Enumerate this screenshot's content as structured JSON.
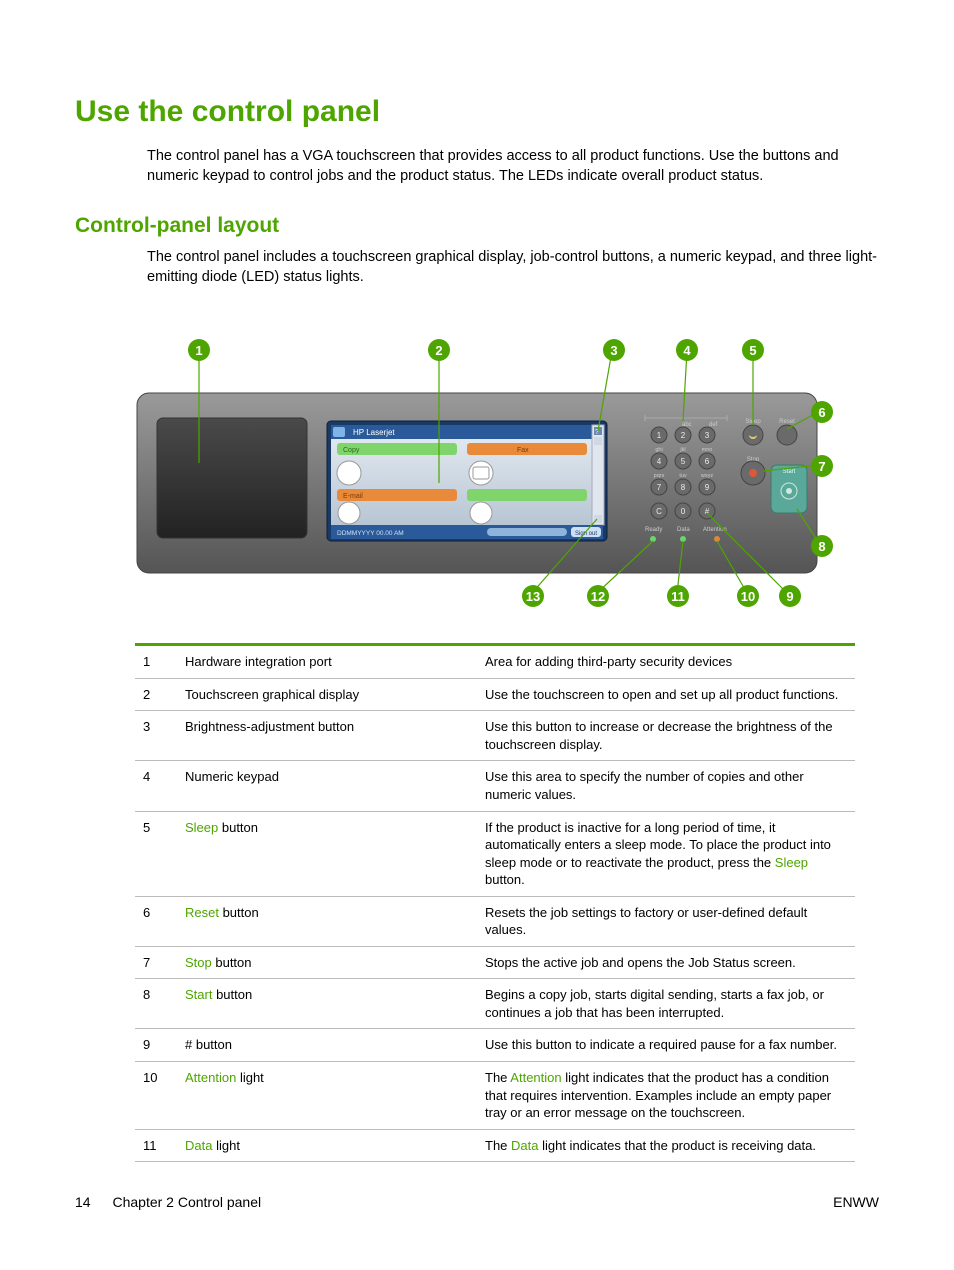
{
  "title": "Use the control panel",
  "intro": "The control panel has a VGA touchscreen that provides access to all product functions. Use the buttons and numeric keypad to control jobs and the product status. The LEDs indicate overall product status.",
  "section_title": "Control-panel layout",
  "section_intro": "The control panel includes a touchscreen graphical display, job-control buttons, a numeric keypad, and three light-emitting diode (LED) status lights.",
  "diagram": {
    "device_label": "HP Laserjet",
    "screen_labels": {
      "copy": "Copy",
      "fax": "Fax",
      "email": "E-mail",
      "date": "DDMMYYYY  00.00 AM",
      "signout": "Sign out"
    },
    "keypad_top": [
      "abc",
      "def"
    ],
    "keypad": [
      "1",
      "2",
      "3",
      "ghi",
      "jkl",
      "mno",
      "4",
      "5",
      "6",
      "pqrs",
      "tuv",
      "wxyz",
      "7",
      "8",
      "9",
      "C",
      "0",
      "#"
    ],
    "buttons": {
      "sleep": "Sleep",
      "reset": "Reset",
      "stop": "Stop",
      "start": "Start"
    },
    "leds": [
      "Ready",
      "Data",
      "Attention"
    ],
    "callouts": [
      "1",
      "2",
      "3",
      "4",
      "5",
      "6",
      "7",
      "8",
      "9",
      "10",
      "11",
      "12",
      "13"
    ]
  },
  "table": [
    {
      "n": "1",
      "name_plain": "Hardware integration port",
      "desc_plain": "Area for adding third-party security devices"
    },
    {
      "n": "2",
      "name_plain": "Touchscreen graphical display",
      "desc_plain": "Use the touchscreen to open and set up all product functions."
    },
    {
      "n": "3",
      "name_plain": "Brightness-adjustment button",
      "desc_plain": "Use this button to increase or decrease the brightness of the touchscreen display."
    },
    {
      "n": "4",
      "name_plain": "Numeric keypad",
      "desc_plain": "Use this area to specify the number of copies and other numeric values."
    },
    {
      "n": "5",
      "name_html": "<span class='kw'>Sleep</span> button",
      "desc_html": "If the product is inactive for a long period of time, it automatically enters a sleep mode. To place the product into sleep mode or to reactivate the product, press the <span class='kw'>Sleep</span> button."
    },
    {
      "n": "6",
      "name_html": "<span class='kw'>Reset</span> button",
      "desc_plain": "Resets the job settings to factory or user-defined default values."
    },
    {
      "n": "7",
      "name_html": "<span class='kw'>Stop</span> button",
      "desc_plain": "Stops the active job and opens the Job Status screen."
    },
    {
      "n": "8",
      "name_html": "<span class='kw'>Start</span> button",
      "desc_plain": "Begins a copy job, starts digital sending, starts a fax job, or continues a job that has been interrupted."
    },
    {
      "n": "9",
      "name_plain": "# button",
      "desc_plain": "Use this button to indicate a required pause for a fax number."
    },
    {
      "n": "10",
      "name_html": "<span class='kw'>Attention</span> light",
      "desc_html": "The <span class='kw'>Attention</span> light indicates that the product has a condition that requires intervention. Examples include an empty paper tray or an error message on the touchscreen."
    },
    {
      "n": "11",
      "name_html": "<span class='kw'>Data</span> light",
      "desc_html": "The <span class='kw'>Data</span> light indicates that the product is receiving data."
    }
  ],
  "footer": {
    "page": "14",
    "chapter": "Chapter 2   Control panel",
    "right": "ENWW"
  }
}
